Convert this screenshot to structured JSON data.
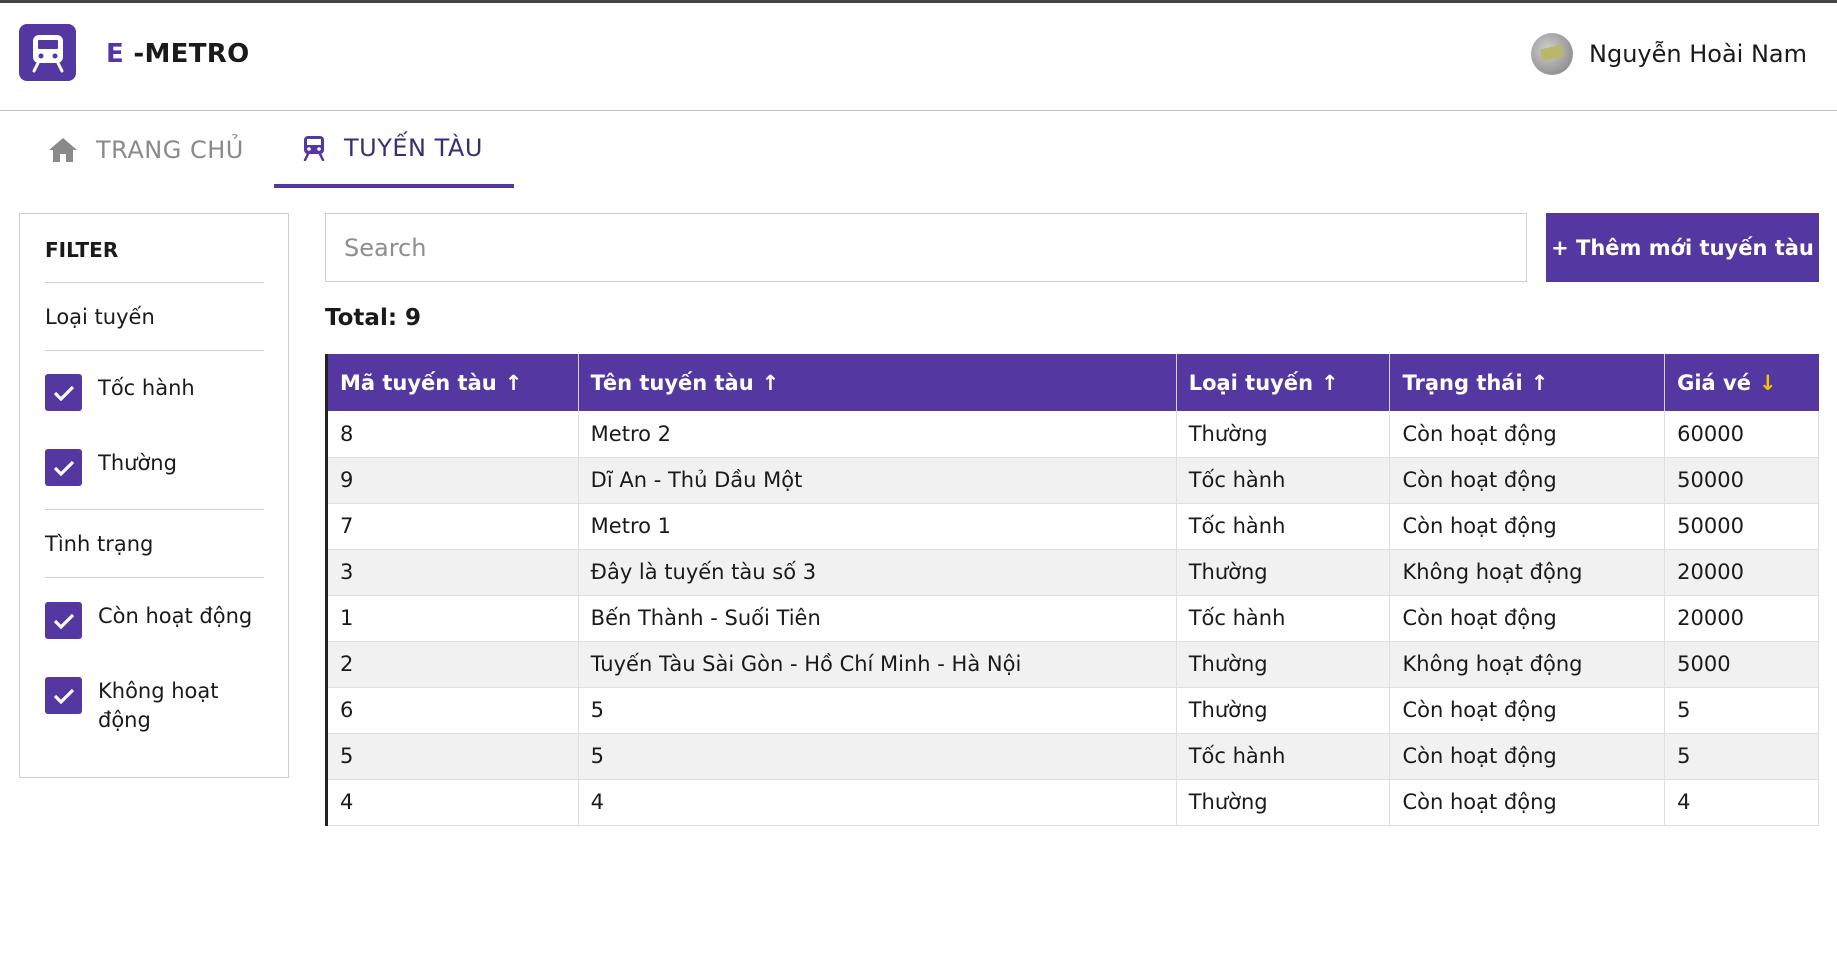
{
  "header": {
    "brand_e": "E",
    "brand_rest": "-METRO",
    "user_name": "Nguyễn Hoài Nam"
  },
  "tabs": [
    {
      "label": "TRANG CHỦ",
      "icon": "home-icon",
      "active": false
    },
    {
      "label": "TUYẾN TÀU",
      "icon": "train-icon",
      "active": true
    }
  ],
  "filter": {
    "title": "FILTER",
    "section_type": "Loại tuyến",
    "type_options": [
      {
        "label": "Tốc hành",
        "checked": true
      },
      {
        "label": "Thường",
        "checked": true
      }
    ],
    "section_status": "Tình trạng",
    "status_options": [
      {
        "label": "Còn hoạt động",
        "checked": true
      },
      {
        "label": "Không hoạt động",
        "checked": true
      }
    ]
  },
  "search": {
    "placeholder": "Search",
    "value": ""
  },
  "add_button": "+ Thêm mới tuyến tàu",
  "total_label": "Total: 9",
  "table": {
    "columns": [
      {
        "label": "Mã tuyến tàu",
        "sort": "up"
      },
      {
        "label": "Tên tuyến tàu",
        "sort": "up"
      },
      {
        "label": "Loại tuyến",
        "sort": "up"
      },
      {
        "label": "Trạng thái",
        "sort": "up"
      },
      {
        "label": "Giá vé",
        "sort": "down"
      }
    ],
    "rows": [
      [
        "8",
        "Metro 2",
        "Thường",
        "Còn hoạt động",
        "60000"
      ],
      [
        "9",
        "Dĩ An - Thủ Dầu Một",
        "Tốc hành",
        "Còn hoạt động",
        "50000"
      ],
      [
        "7",
        "Metro 1",
        "Tốc hành",
        "Còn hoạt động",
        "50000"
      ],
      [
        "3",
        "Đây là tuyến tàu số 3",
        "Thường",
        "Không hoạt động",
        "20000"
      ],
      [
        "1",
        "Bến Thành - Suối Tiên",
        "Tốc hành",
        "Còn hoạt động",
        "20000"
      ],
      [
        "2",
        "Tuyến Tàu Sài Gòn - Hồ Chí Minh - Hà Nội",
        "Thường",
        "Không hoạt động",
        "5000"
      ],
      [
        "6",
        "5",
        "Thường",
        "Còn hoạt động",
        "5"
      ],
      [
        "5",
        "5",
        "Tốc hành",
        "Còn hoạt động",
        "5"
      ],
      [
        "4",
        "4",
        "Thường",
        "Còn hoạt động",
        "4"
      ]
    ]
  },
  "colors": {
    "accent": "#5437a0",
    "sort_desc_arrow": "#f5c400"
  }
}
